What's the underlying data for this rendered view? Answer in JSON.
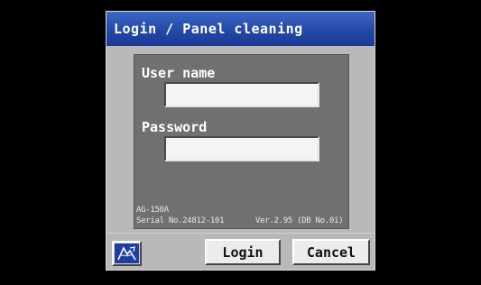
{
  "window": {
    "title": "Login / Panel cleaning"
  },
  "form": {
    "username_label": "User name",
    "username_value": "",
    "password_label": "Password",
    "password_value": ""
  },
  "device": {
    "model": "AG-150A",
    "serial": "Serial No.24812-101",
    "version": "Ver.2.95 (DB No.01)"
  },
  "buttons": {
    "login_label": "Login",
    "cancel_label": "Cancel",
    "panel_cleaning_icon": "panel-cleaning-icon"
  },
  "colors": {
    "titlebar": "#2448a8",
    "background": "#b9b9b9",
    "panel": "#707070"
  }
}
